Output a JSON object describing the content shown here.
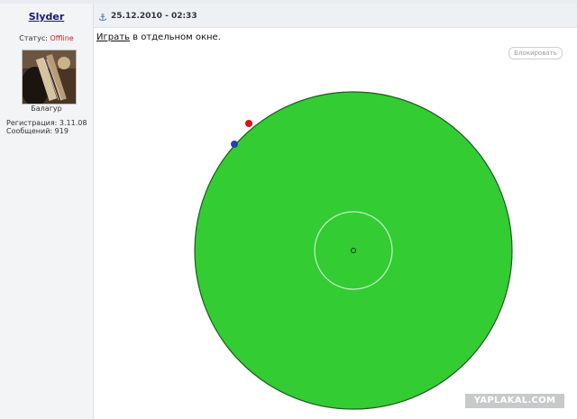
{
  "user": {
    "name": "Slyder",
    "status_label": "Статус:",
    "status_value": "Offline",
    "rank": "Балагур",
    "registered": "Регистрация: 3.11.08",
    "messages": "Сообщений: 919"
  },
  "post": {
    "date": "25.12.2010 - 02:33",
    "play_link": "Играть",
    "play_rest": " в отдельном окне.",
    "block_button": "Блокировать"
  },
  "game": {
    "field_color": "#33cc33",
    "inner_ring_color": "#c8f0c8",
    "dot_red_color": "#dd1111",
    "dot_blue_color": "#2a3ea8"
  },
  "watermark": "YAPLAKAL.COM"
}
